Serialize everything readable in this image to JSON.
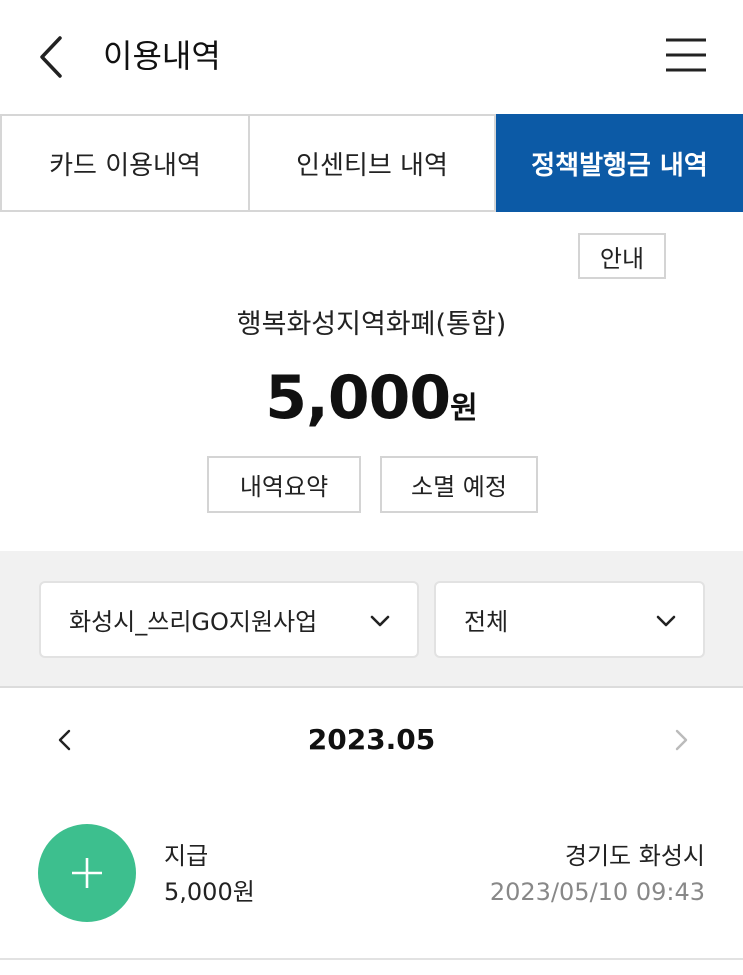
{
  "header": {
    "title": "이용내역",
    "back_icon": "chevron-left-icon",
    "menu_icon": "hamburger-menu-icon"
  },
  "tabs": [
    {
      "label": "카드 이용내역",
      "active": false
    },
    {
      "label": "인센티브 내역",
      "active": false
    },
    {
      "label": "정책발행금 내역",
      "active": true
    }
  ],
  "summary": {
    "guide_label": "안내",
    "currency_name": "행복화성지역화폐(통합)",
    "balance_amount": "5,000",
    "balance_unit": "원",
    "summary_button": "내역요약",
    "expire_button": "소멸 예정"
  },
  "filters": {
    "program_select": "화성시_쓰리GO지원사업",
    "type_select": "전체"
  },
  "month_nav": {
    "label": "2023.05"
  },
  "transactions": [
    {
      "icon": "plus-icon",
      "type": "지급",
      "amount": "5,000원",
      "place": "경기도 화성시",
      "datetime": "2023/05/10 09:43"
    }
  ],
  "colors": {
    "active_tab": "#0c5aa6",
    "credit_icon": "#3dbf8e",
    "filter_band": "#f1f1f1",
    "muted_text": "#888888"
  }
}
